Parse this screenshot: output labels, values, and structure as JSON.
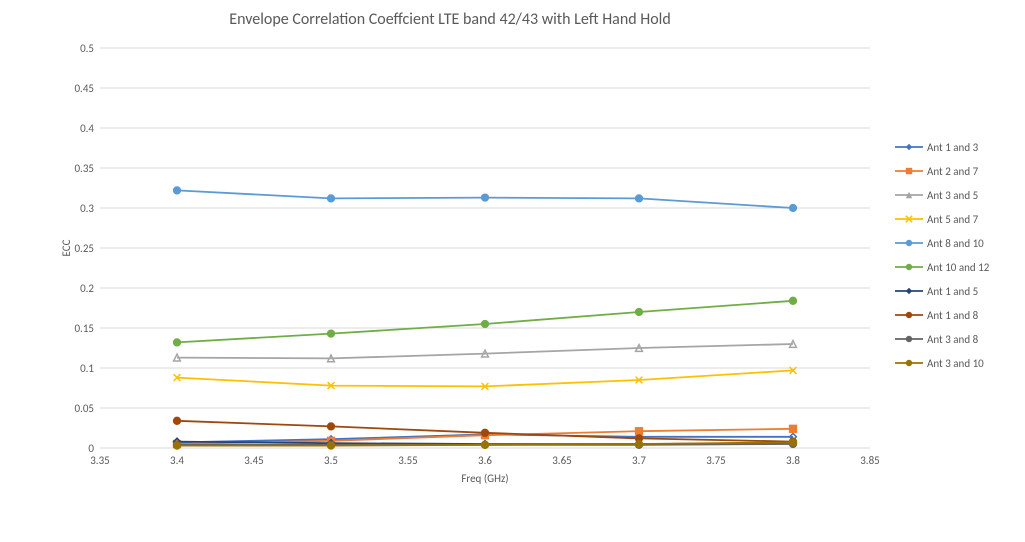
{
  "chart_data": {
    "type": "line",
    "title": "Envelope Correlation Coeffcient LTE band 42/43 with Left Hand Hold",
    "xlabel": "Freq (GHz)",
    "ylabel": "ECC",
    "xlim": [
      3.35,
      3.85
    ],
    "ylim": [
      0,
      0.5
    ],
    "xticks": [
      3.35,
      3.4,
      3.45,
      3.5,
      3.55,
      3.6,
      3.65,
      3.7,
      3.75,
      3.8,
      3.85
    ],
    "yticks": [
      0,
      0.05,
      0.1,
      0.15,
      0.2,
      0.25,
      0.3,
      0.35,
      0.4,
      0.45,
      0.5
    ],
    "x": [
      3.4,
      3.5,
      3.6,
      3.7,
      3.8
    ],
    "series": [
      {
        "name": "Ant 1 and 3",
        "color": "#4472C4",
        "marker": "diamond",
        "values": [
          0.007,
          0.011,
          0.017,
          0.014,
          0.014
        ]
      },
      {
        "name": "Ant 2 and 7",
        "color": "#ED7D31",
        "marker": "square",
        "values": [
          0.005,
          0.009,
          0.016,
          0.021,
          0.024
        ]
      },
      {
        "name": "Ant 3 and 5",
        "color": "#A5A5A5",
        "marker": "triangle",
        "values": [
          0.113,
          0.112,
          0.118,
          0.125,
          0.13
        ]
      },
      {
        "name": "Ant 5 and 7",
        "color": "#FFC000",
        "marker": "x",
        "values": [
          0.088,
          0.078,
          0.077,
          0.085,
          0.097
        ]
      },
      {
        "name": "Ant 8 and 10",
        "color": "#5B9BD5",
        "marker": "circle",
        "values": [
          0.322,
          0.312,
          0.313,
          0.312,
          0.3
        ]
      },
      {
        "name": "Ant 10 and 12",
        "color": "#70AD47",
        "marker": "circle",
        "values": [
          0.132,
          0.143,
          0.155,
          0.17,
          0.184
        ]
      },
      {
        "name": "Ant 1 and 5",
        "color": "#264478",
        "marker": "diamond",
        "values": [
          0.008,
          0.006,
          0.005,
          0.005,
          0.006
        ]
      },
      {
        "name": "Ant 1 and 8",
        "color": "#9E480E",
        "marker": "circle",
        "values": [
          0.034,
          0.027,
          0.019,
          0.012,
          0.008
        ]
      },
      {
        "name": "Ant 3 and 8",
        "color": "#636363",
        "marker": "circle",
        "values": [
          0.004,
          0.004,
          0.004,
          0.004,
          0.005
        ]
      },
      {
        "name": "Ant 3 and 10",
        "color": "#997300",
        "marker": "circle",
        "values": [
          0.003,
          0.003,
          0.004,
          0.005,
          0.007
        ]
      }
    ]
  }
}
